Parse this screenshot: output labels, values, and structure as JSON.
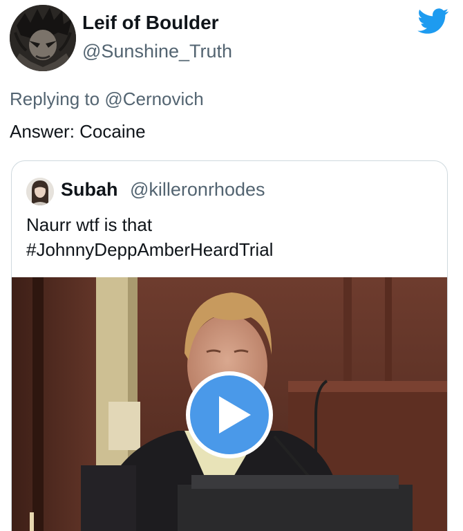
{
  "tweet": {
    "display_name": "Leif of Boulder",
    "handle": "@Sunshine_Truth",
    "replying_to_prefix": "Replying to ",
    "replying_to_user": "@Cernovich",
    "text": "Answer: Cocaine",
    "logo_icon": "twitter-bird-icon",
    "brand_color": "#1d9bf0"
  },
  "quoted_tweet": {
    "display_name": "Subah",
    "handle": "@killeronrhodes",
    "text_lines": [
      "Naurr wtf is that",
      "#JohnnyDeppAmberHeardTrial"
    ],
    "media": {
      "type": "video",
      "play_icon": "play-icon",
      "play_color": "#4a99e9"
    }
  }
}
